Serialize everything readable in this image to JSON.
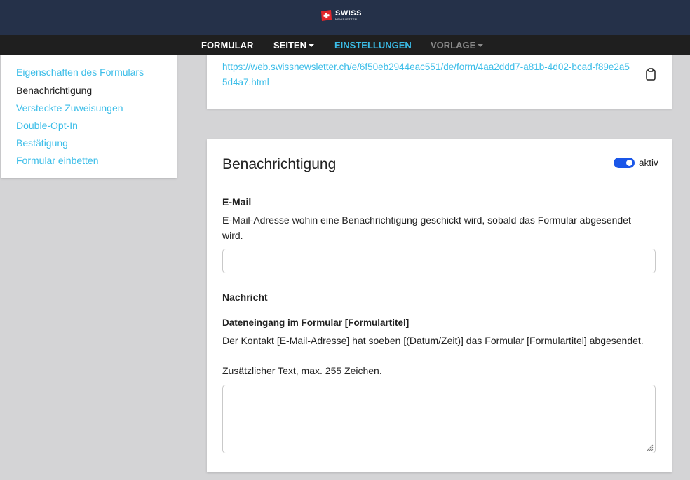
{
  "header": {
    "logo_main": "SWISS",
    "logo_sub": "NEWSLETTER"
  },
  "nav": {
    "items": [
      {
        "label": "FORMULAR"
      },
      {
        "label": "SEITEN"
      },
      {
        "label": "EINSTELLUNGEN"
      },
      {
        "label": "VORLAGE"
      }
    ]
  },
  "sidebar": {
    "items": [
      {
        "label": "Eigenschaften des Formulars"
      },
      {
        "label": "Benachrichtigung"
      },
      {
        "label": "Versteckte Zuweisungen"
      },
      {
        "label": "Double-Opt-In"
      },
      {
        "label": "Bestätigung"
      },
      {
        "label": "Formular einbetten"
      }
    ]
  },
  "embed": {
    "url": "https://web.swissnewsletter.ch/e/6f50eb2944eac551/de/form/4aa2ddd7-a81b-4d02-bcad-f89e2a55d4a7.html",
    "copy_icon": "clipboard-icon"
  },
  "notification": {
    "title": "Benachrichtigung",
    "toggle_label": "aktiv",
    "toggle_on": true,
    "email_label": "E-Mail",
    "email_help": "E-Mail-Adresse wohin eine Benachrichtigung geschickt wird, sobald das Formular abgesendet wird.",
    "email_value": "",
    "message_label": "Nachricht",
    "message_subject": "Dateneingang im Formular [Formulartitel]",
    "message_body": "Der Kontakt [E-Mail-Adresse] hat soeben [(Datum/Zeit)] das Formular [Formulartitel] abgesendet.",
    "extra_label": "Zusätzlicher Text, max. 255 Zeichen.",
    "extra_value": ""
  },
  "colors": {
    "header_bg": "#253149",
    "nav_bg": "#1f1f1f",
    "accent": "#3bbde8",
    "toggle": "#1a56e8",
    "page_bg": "#d4d4d6"
  }
}
